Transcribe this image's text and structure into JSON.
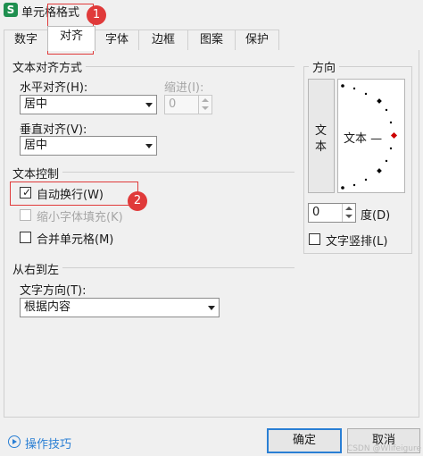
{
  "window": {
    "title": "单元格格式",
    "app_icon_letter": "S"
  },
  "tabs": [
    {
      "label": "数字"
    },
    {
      "label": "对齐"
    },
    {
      "label": "字体"
    },
    {
      "label": "边框"
    },
    {
      "label": "图案"
    },
    {
      "label": "保护"
    }
  ],
  "active_tab": "对齐",
  "text_alignment": {
    "group_title": "文本对齐方式",
    "horizontal_label": "水平对齐(H):",
    "horizontal_value": "居中",
    "indent_label": "缩进(I):",
    "indent_value": "0",
    "vertical_label": "垂直对齐(V):",
    "vertical_value": "居中"
  },
  "text_control": {
    "group_title": "文本控制",
    "wrap_text_label": "自动换行(W)",
    "wrap_text_checked": true,
    "shrink_to_fit_label": "缩小字体填充(K)",
    "shrink_to_fit_checked": false,
    "merge_cells_label": "合并单元格(M)",
    "merge_cells_checked": false
  },
  "rtl": {
    "group_title": "从右到左",
    "direction_label": "文字方向(T):",
    "direction_value": "根据内容"
  },
  "orientation": {
    "group_title": "方向",
    "vertical_text_char1": "文",
    "vertical_text_char2": "本",
    "dial_text": "文本 —",
    "degree_value": "0",
    "degree_label": "度(D)",
    "vertical_text_label": "文字竖排(L)",
    "vertical_text_checked": false
  },
  "footer": {
    "help_link": "操作技巧",
    "ok_label": "确定",
    "cancel_label": "取消"
  },
  "annotations": {
    "badge1": "1",
    "badge2": "2"
  },
  "watermark": "CSDN @Wlifeigure",
  "colors": {
    "accent": "#2a7fd4",
    "callout": "#e03a3a",
    "app_icon": "#1f8f4f",
    "dial_pointer": "#cc0000"
  }
}
